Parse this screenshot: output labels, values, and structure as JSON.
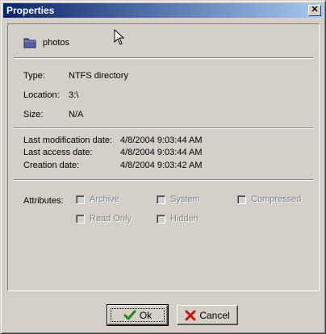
{
  "window": {
    "title": "Properties"
  },
  "item": {
    "name": "photos",
    "icon": "folder-icon"
  },
  "info": {
    "type_label": "Type:",
    "type_value": "NTFS directory",
    "location_label": "Location:",
    "location_value": "3:\\",
    "size_label": "Size:",
    "size_value": "N/A"
  },
  "dates": {
    "modified_label": "Last modification date:",
    "modified_value": "4/8/2004 9:03:44 AM",
    "accessed_label": "Last access date:",
    "accessed_value": "4/8/2004 9:03:44 AM",
    "created_label": "Creation date:",
    "created_value": "4/8/2004 9:03:42 AM"
  },
  "attributes": {
    "label": "Attributes:",
    "archive": "Archive",
    "system": "System",
    "compressed": "Compressed",
    "read_only": "Read Only",
    "hidden": "Hidden"
  },
  "buttons": {
    "ok": "Ok",
    "cancel": "Cancel"
  },
  "colors": {
    "titlebar_start": "#0a246a",
    "titlebar_end": "#a6caf0",
    "face": "#d4d0c8"
  }
}
